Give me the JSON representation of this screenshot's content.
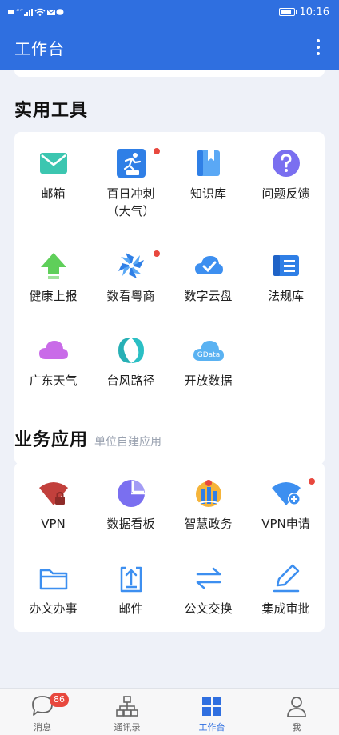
{
  "status_bar": {
    "time": "10:16",
    "left_text": "“”"
  },
  "app_bar": {
    "title": "工作台"
  },
  "tools_section": {
    "title": "实用工具",
    "items": [
      {
        "label": "邮箱",
        "icon": "mail-icon"
      },
      {
        "label": "百日冲刺\n（大气）",
        "icon": "sprint-runner-icon",
        "dot": true
      },
      {
        "label": "知识库",
        "icon": "book-icon"
      },
      {
        "label": "问题反馈",
        "icon": "question-icon"
      },
      {
        "label": "健康上报",
        "icon": "upload-arrow-icon"
      },
      {
        "label": "数看粤商",
        "icon": "pinwheel-icon",
        "dot": true
      },
      {
        "label": "数字云盘",
        "icon": "cloud-check-icon"
      },
      {
        "label": "法规库",
        "icon": "document-icon"
      },
      {
        "label": "广东天气",
        "icon": "weather-cloud-icon"
      },
      {
        "label": "台风路径",
        "icon": "typhoon-icon"
      },
      {
        "label": "开放数据",
        "icon": "gdata-cloud-icon",
        "icon_text": "GData"
      }
    ]
  },
  "apps_section": {
    "title": "业务应用",
    "subtitle": "单位自建应用",
    "items": [
      {
        "label": "VPN",
        "icon": "vpn-wifi-lock-icon"
      },
      {
        "label": "数据看板",
        "icon": "pie-chart-icon"
      },
      {
        "label": "智慧政务",
        "icon": "gov-building-icon"
      },
      {
        "label": "VPN申请",
        "icon": "wifi-plus-icon",
        "dot": true
      },
      {
        "label": "办文办事",
        "icon": "folder-icon"
      },
      {
        "label": "邮件",
        "icon": "clipboard-upload-icon"
      },
      {
        "label": "公文交换",
        "icon": "exchange-arrows-icon"
      },
      {
        "label": "集成审批",
        "icon": "pen-edit-icon"
      }
    ]
  },
  "tab_bar": {
    "tabs": [
      {
        "label": "消息",
        "icon": "chat-bubble-icon",
        "badge": "86"
      },
      {
        "label": "通讯录",
        "icon": "org-chart-icon"
      },
      {
        "label": "工作台",
        "icon": "grid-icon",
        "active": true
      },
      {
        "label": "我",
        "icon": "person-icon"
      }
    ]
  },
  "colors": {
    "primary": "#2f6fe0",
    "badge": "#e8483e",
    "background": "#eef1f8"
  }
}
